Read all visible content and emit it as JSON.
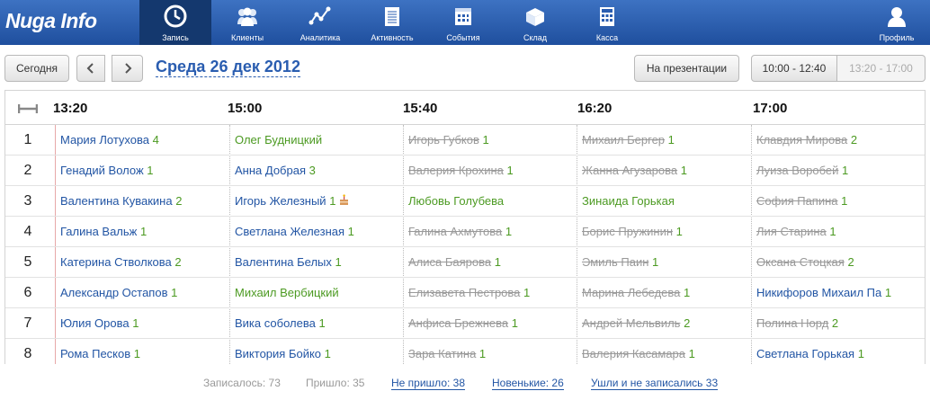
{
  "app": {
    "logo": "Nuga Info"
  },
  "nav": {
    "items": [
      {
        "label": "Запись",
        "icon": "clock-icon"
      },
      {
        "label": "Клиенты",
        "icon": "users-icon"
      },
      {
        "label": "Аналитика",
        "icon": "analytics-icon"
      },
      {
        "label": "Активность",
        "icon": "notepad-icon"
      },
      {
        "label": "События",
        "icon": "calendar-icon"
      },
      {
        "label": "Склад",
        "icon": "box-icon"
      },
      {
        "label": "Касса",
        "icon": "calculator-icon"
      }
    ],
    "profile": {
      "label": "Профиль",
      "icon": "user-icon"
    }
  },
  "toolbar": {
    "today": "Сегодня",
    "date": "Среда 26 дек 2012",
    "presentation": "На презентации",
    "ranges": [
      "10:00 - 12:40",
      "13:20 - 17:00"
    ]
  },
  "schedule": {
    "times": [
      "13:20",
      "15:00",
      "15:40",
      "16:20",
      "17:00"
    ],
    "rows": [
      {
        "num": "1",
        "cells": [
          {
            "name": "Мария Лотухова",
            "count": "4",
            "status": "blue"
          },
          {
            "name": "Олег Будницкий",
            "count": "",
            "status": "green"
          },
          {
            "name": "Игорь Губков",
            "count": "1",
            "status": "gray"
          },
          {
            "name": "Михаил Бергер",
            "count": "1",
            "status": "gray"
          },
          {
            "name": "Клавдия Мирова",
            "count": "2",
            "status": "gray"
          }
        ]
      },
      {
        "num": "2",
        "cells": [
          {
            "name": "Генадий Волож",
            "count": "1",
            "status": "blue"
          },
          {
            "name": "Анна Добрая",
            "count": "3",
            "status": "blue"
          },
          {
            "name": "Валерия Крохина",
            "count": "1",
            "status": "gray"
          },
          {
            "name": "Жанна Агузарова",
            "count": "1",
            "status": "gray"
          },
          {
            "name": "Луиза Воробей",
            "count": "1",
            "status": "gray"
          }
        ]
      },
      {
        "num": "3",
        "cells": [
          {
            "name": "Валентина Кувакина",
            "count": "2",
            "status": "blue"
          },
          {
            "name": "Игорь Железный",
            "count": "1",
            "status": "blue",
            "cake": true
          },
          {
            "name": "Любовь Голубева",
            "count": "",
            "status": "green"
          },
          {
            "name": "Зинаида Горькая",
            "count": "",
            "status": "green"
          },
          {
            "name": "София Папина",
            "count": "1",
            "status": "gray"
          }
        ]
      },
      {
        "num": "4",
        "cells": [
          {
            "name": "Галина Вальж",
            "count": "1",
            "status": "blue"
          },
          {
            "name": "Светлана Железная",
            "count": "1",
            "status": "blue"
          },
          {
            "name": "Галина Ахмутова",
            "count": "1",
            "status": "gray"
          },
          {
            "name": "Борис Пружинин",
            "count": "1",
            "status": "gray"
          },
          {
            "name": "Лия Старина",
            "count": "1",
            "status": "gray"
          }
        ]
      },
      {
        "num": "5",
        "cells": [
          {
            "name": "Катерина Стволкова",
            "count": "2",
            "status": "blue"
          },
          {
            "name": "Валентина Белых",
            "count": "1",
            "status": "blue"
          },
          {
            "name": "Алиса Баярова",
            "count": "1",
            "status": "gray"
          },
          {
            "name": "Эмиль Паин",
            "count": "1",
            "status": "gray"
          },
          {
            "name": "Оксана Стоцкая",
            "count": "2",
            "status": "gray"
          }
        ]
      },
      {
        "num": "6",
        "cells": [
          {
            "name": "Александр Остапов",
            "count": "1",
            "status": "blue"
          },
          {
            "name": "Михаил Вербицкий",
            "count": "",
            "status": "green"
          },
          {
            "name": "Елизавета Пестрова",
            "count": "1",
            "status": "gray"
          },
          {
            "name": "Марина Лебедева",
            "count": "1",
            "status": "gray"
          },
          {
            "name": "Никифоров Михаил Па",
            "count": "1",
            "status": "blue"
          }
        ]
      },
      {
        "num": "7",
        "cells": [
          {
            "name": "Юлия Орова",
            "count": "1",
            "status": "blue"
          },
          {
            "name": "Вика соболева",
            "count": "1",
            "status": "blue"
          },
          {
            "name": "Анфиса Брежнева",
            "count": "1",
            "status": "gray"
          },
          {
            "name": "Андрей Мельвиль",
            "count": "2",
            "status": "gray"
          },
          {
            "name": "Полина Норд",
            "count": "2",
            "status": "gray"
          }
        ]
      },
      {
        "num": "8",
        "cells": [
          {
            "name": "Рома Песков",
            "count": "1",
            "status": "blue"
          },
          {
            "name": "Виктория Бойко",
            "count": "1",
            "status": "blue"
          },
          {
            "name": "Зара Катина",
            "count": "1",
            "status": "gray"
          },
          {
            "name": "Валерия Касамара",
            "count": "1",
            "status": "gray"
          },
          {
            "name": "Светлана Горькая",
            "count": "1",
            "status": "blue"
          }
        ]
      }
    ]
  },
  "footer": {
    "signed": "Записалось: 73",
    "came": "Пришло: 35",
    "not_came": "Не пришло: 38",
    "newcomers": "Новенькие: 26",
    "left_unsigned": "Ушли и не записались 33"
  },
  "colors": {
    "nav": "#2a5db0",
    "active_nav": "#14386e",
    "link": "#2255a4",
    "green": "#4c9a22",
    "gray": "#999999"
  }
}
